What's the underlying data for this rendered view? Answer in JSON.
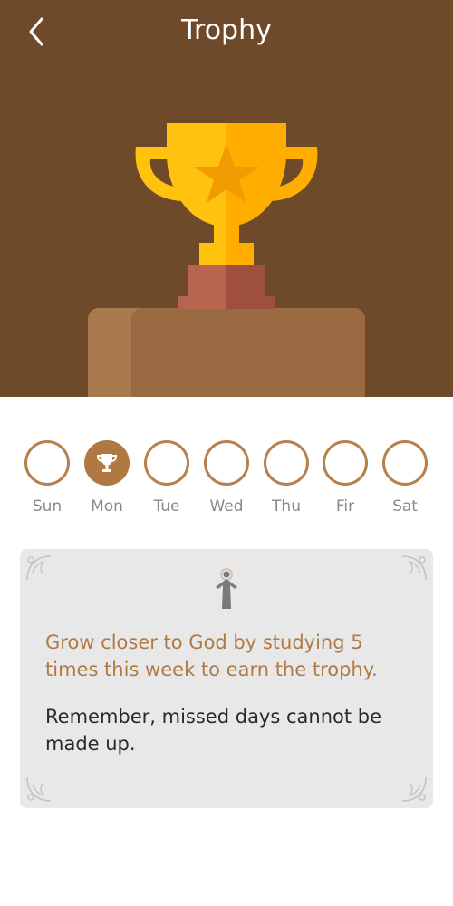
{
  "header": {
    "title": "Trophy",
    "back_icon": "chevron-left-icon"
  },
  "colors": {
    "hero_background": "#6e4a2a",
    "accent": "#b07842",
    "goal_text": "#b07a44",
    "card_background": "#e9e8e8",
    "trophy_gold": "#ffc20e"
  },
  "week": {
    "days": [
      {
        "label": "Sun",
        "achieved": false
      },
      {
        "label": "Mon",
        "achieved": true,
        "icon": "trophy-icon"
      },
      {
        "label": "Tue",
        "achieved": false
      },
      {
        "label": "Wed",
        "achieved": false
      },
      {
        "label": "Thu",
        "achieved": false
      },
      {
        "label": "Fir",
        "achieved": false
      },
      {
        "label": "Sat",
        "achieved": false
      }
    ]
  },
  "card": {
    "icon": "jesus-figure-icon",
    "goal_text": "Grow closer to God by studying 5 times this week to earn the trophy.",
    "note_text": "Remember, missed days cannot be made up."
  }
}
